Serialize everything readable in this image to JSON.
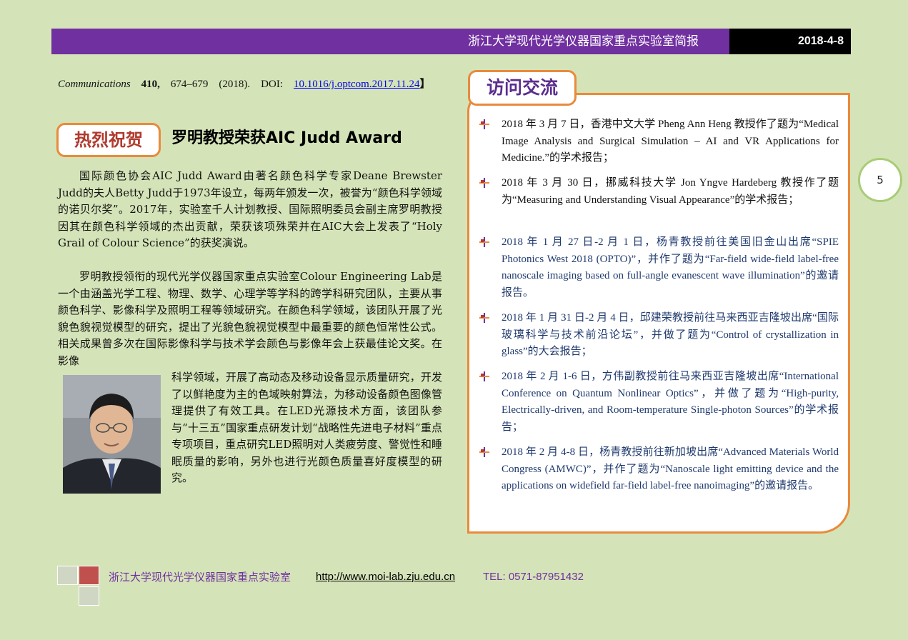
{
  "header": {
    "title": "浙江大学现代光学仪器国家重点实验室简报",
    "date": "2018-4-8"
  },
  "citation": {
    "journal": "Communications",
    "volume": "410,",
    "pages": "674–679",
    "year": "(2018).",
    "doi_label": "DOI:",
    "doi_link": "10.1016/j.optcom.2017.11.24",
    "close": "】"
  },
  "article": {
    "badge": "热烈祝贺",
    "title": "罗明教授荣获AIC Judd Award",
    "p1": "国际颜色协会AIC Judd Award由著名颜色科学专家Deane Brewster Judd的夫人Betty Judd于1973年设立，每两年颁发一次，被誉为“颜色科学领域的诺贝尔奖”。2017年，实验室千人计划教授、国际照明委员会副主席罗明教授因其在颜色科学领域的杰出贡献，荣获该项殊荣并在AIC大会上发表了“Holy Grail of Colour Science”的获奖演说。",
    "p2": "罗明教授领衔的现代光学仪器国家重点实验室Colour Engineering Lab是一个由涵盖光学工程、物理、数学、心理学等学科的跨学科研究团队，主要从事颜色科学、影像科学及照明工程等领域研究。在颜色科学领域，该团队开展了光貌色貌视觉模型的研究，提出了光貌色貌视觉模型中最重要的颜色恒常性公式。相关成果曾多次在国际影像科学与技术学会颜色与影像年会上获最佳论文奖。在影像",
    "p3": "科学领域，开展了高动态及移动设备显示质量研究，开发了以鲜艳度为主的色域映射算法，为移动设备颜色图像管理提供了有效工具。在LED光源技术方面，该团队参与“十三五”国家重点研发计划“战略性先进电子材料”重点专项项目，重点研究LED照明对人类疲劳度、警觉性和睡眠质量的影响，另外也进行光颜色质量喜好度模型的研究。"
  },
  "exchange": {
    "badge": "访问交流",
    "items": [
      "2018 年 3 月 7 日，香港中文大学 Pheng Ann Heng 教授作了题为“Medical Image Analysis and Surgical Simulation – AI and VR Applications for Medicine.”的学术报告；",
      "2018 年 3 月 30 日，挪威科技大学 Jon Yngve Hardeberg 教授作了题为“Measuring and Understanding Visual Appearance”的学术报告；",
      "2018 年 1 月 27 日-2 月 1 日，杨青教授前往美国旧金山出席“SPIE Photonics West 2018 (OPTO)”，并作了题为“Far-field wide-field label-free nanoscale imaging based on full-angle evanescent wave illumination”的邀请报告。",
      "2018 年 1 月 31 日-2 月 4 日，邱建荣教授前往马来西亚吉隆坡出席“国际玻璃科学与技术前沿论坛”，并做了题为“Control of crystallization in glass”的大会报告；",
      "2018 年 2 月 1-6 日，方伟副教授前往马来西亚吉隆坡出席“International Conference on Quantum Nonlinear Optics”，并做了题为“High-purity, Electrically-driven, and Room-temperature Single-photon Sources”的学术报告；",
      "2018 年 2 月 4-8 日，杨青教授前往新加坡出席“Advanced Materials World Congress (AMWC)”，并作了题为“Nanoscale light emitting device and the applications on widefield far-field label-free nanoimaging”的邀请报告。"
    ]
  },
  "page_number": "5",
  "footer": {
    "lab": "浙江大学现代光学仪器国家重点实验室",
    "url": "http://www.moi-lab.zju.edu.cn",
    "tel": "TEL: 0571-87951432"
  },
  "colors": {
    "header": "#7030a0",
    "background": "#d5e4b8",
    "accent_orange": "#e98a3c",
    "link_blue": "#0000ee",
    "item_blue": "#1f3a6e"
  }
}
